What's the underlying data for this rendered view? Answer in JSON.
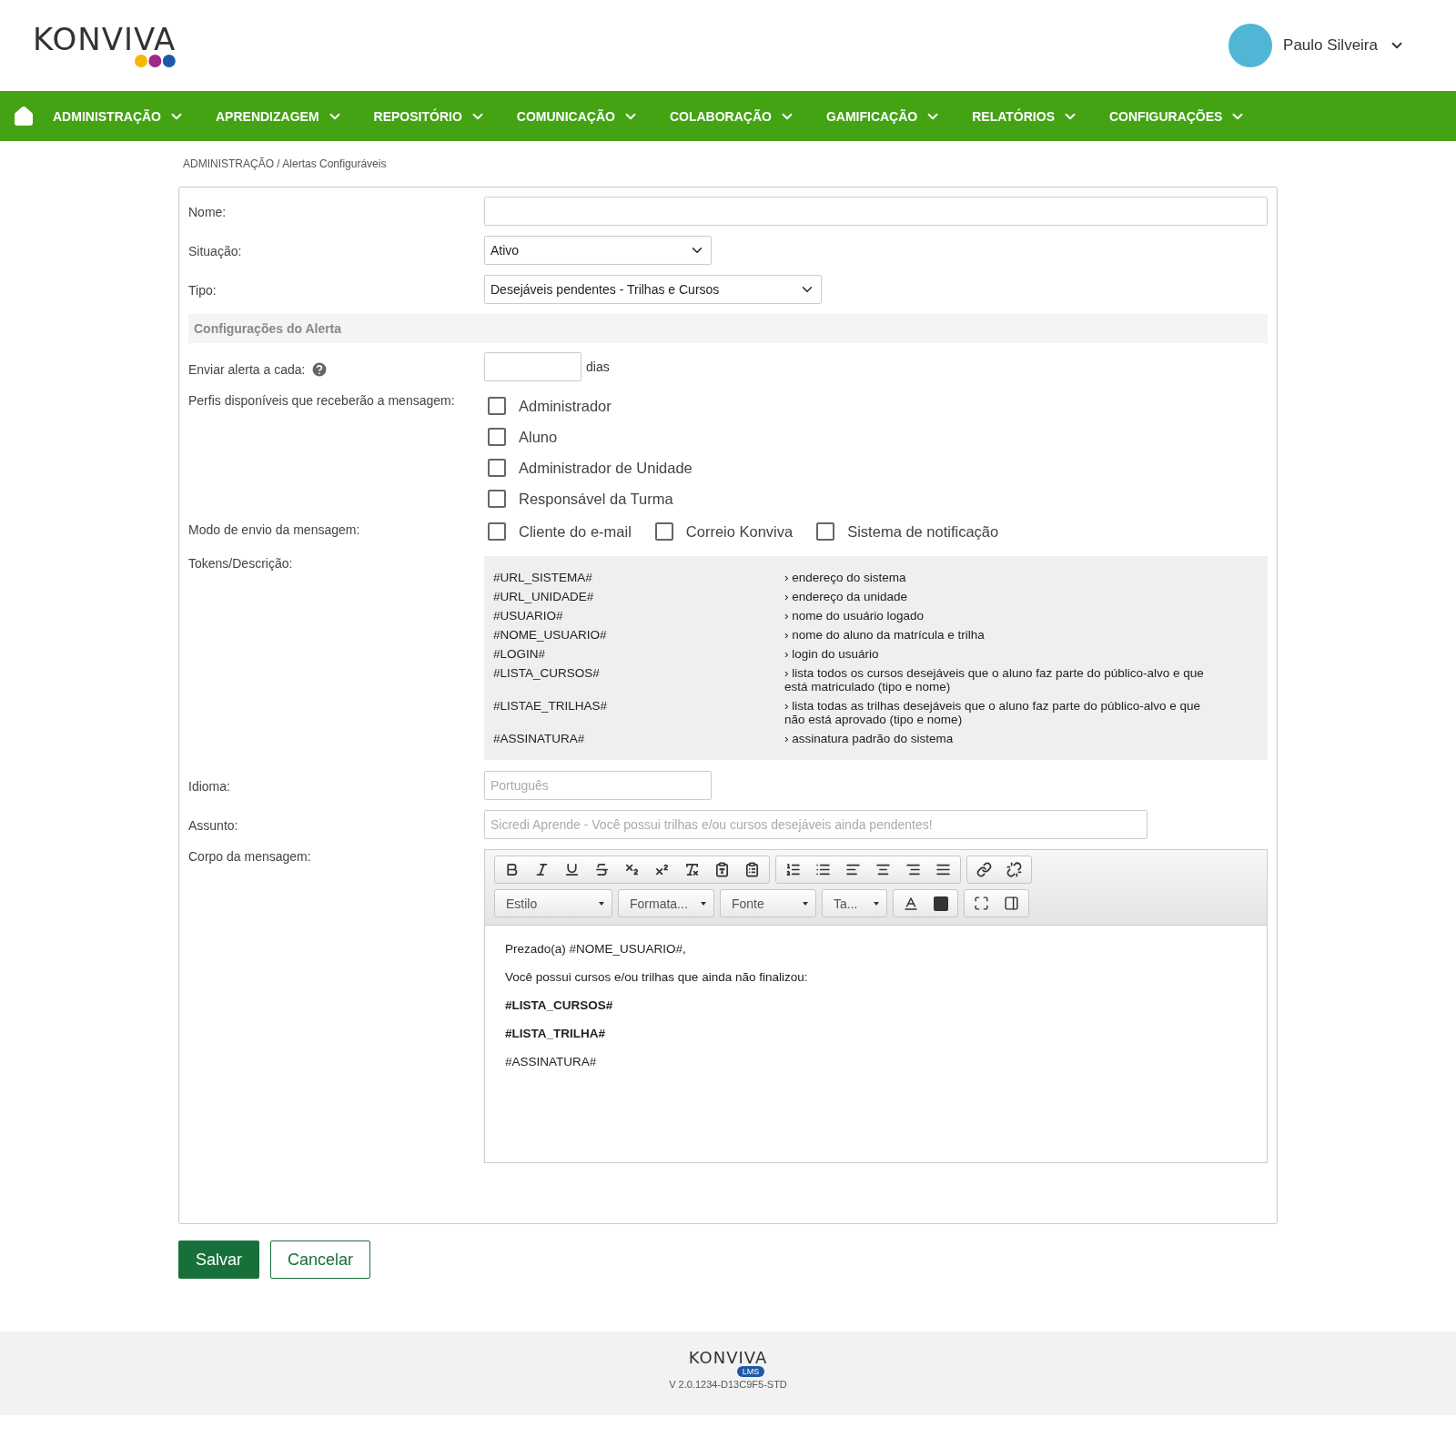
{
  "header": {
    "logo": "KONVIVA",
    "user_name": "Paulo Silveira"
  },
  "nav": {
    "items": [
      "ADMINISTRAÇÃO",
      "APRENDIZAGEM",
      "REPOSITÓRIO",
      "COMUNICAÇÃO",
      "COLABORAÇÃO",
      "GAMIFICAÇÃO",
      "RELATÓRIOS",
      "CONFIGURAÇÕES"
    ]
  },
  "breadcrumb": "ADMINISTRAÇÃO / Alertas Configuráveis",
  "form": {
    "nome": {
      "label": "Nome:"
    },
    "situacao": {
      "label": "Situação:",
      "value": "Ativo"
    },
    "tipo": {
      "label": "Tipo:",
      "value": "Desejáveis pendentes - Trilhas e Cursos"
    },
    "section_title": "Configurações do Alerta",
    "enviar": {
      "label": "Enviar alerta a cada:",
      "unit": "dias"
    },
    "perfis": {
      "label": "Perfis disponíveis que receberão a mensagem:",
      "options": [
        {
          "label": "Administrador",
          "checked": false
        },
        {
          "label": "Aluno",
          "checked": false
        },
        {
          "label": "Administrador de Unidade",
          "checked": false
        },
        {
          "label": "Responsável da Turma",
          "checked": false
        }
      ]
    },
    "modo": {
      "label": "Modo de envio da mensagem:",
      "options": [
        {
          "label": "Cliente do e-mail",
          "checked": false
        },
        {
          "label": "Correio Konviva",
          "checked": false
        },
        {
          "label": "Sistema de notificação",
          "checked": false
        }
      ]
    },
    "tokens": {
      "label": "Tokens/Descrição:",
      "rows": [
        {
          "token": "#URL_SISTEMA#",
          "description": "› endereço do sistema"
        },
        {
          "token": "#URL_UNIDADE#",
          "description": "› endereço da unidade"
        },
        {
          "token": "#USUARIO#",
          "description": "› nome do usuário logado"
        },
        {
          "token": "#NOME_USUARIO#",
          "description": "› nome do aluno da matrícula e trilha"
        },
        {
          "token": "#LOGIN#",
          "description": "› login do usuário"
        },
        {
          "token": "#LISTA_CURSOS#",
          "description": "› lista todos os cursos desejáveis que o aluno faz parte do público-alvo e que está matriculado (tipo e nome)"
        },
        {
          "token": "#LISTAE_TRILHAS#",
          "description": "› lista todas as trilhas desejáveis que o aluno faz parte do público-alvo e que não está aprovado (tipo e nome)"
        },
        {
          "token": "#ASSINATURA#",
          "description": "› assinatura padrão do sistema"
        }
      ]
    },
    "idioma": {
      "label": "Idioma:",
      "placeholder": "Português"
    },
    "assunto": {
      "label": "Assunto:",
      "placeholder": "Sicredi Aprende - Você possui trilhas e/ou cursos desejáveis ainda pendentes!"
    },
    "corpo": {
      "label": "Corpo da mensagem:",
      "combos": [
        "Estilo",
        "Formata...",
        "Fonte",
        "Ta..."
      ],
      "lines": [
        {
          "text": "Prezado(a) #NOME_USUARIO#,",
          "bold": false
        },
        {
          "text": "Você possui cursos e/ou trilhas que ainda não finalizou:",
          "bold": false
        },
        {
          "text": "#LISTA_CURSOS#",
          "bold": true
        },
        {
          "text": "#LISTA_TRILHA#",
          "bold": true
        },
        {
          "text": "#ASSINATURA#",
          "bold": false
        }
      ]
    }
  },
  "buttons": {
    "save": "Salvar",
    "cancel": "Cancelar"
  },
  "footer": {
    "logo": "KONVIVA",
    "badge": "LMS",
    "version": "V 2.0.1234-D13C9F5-STD"
  }
}
